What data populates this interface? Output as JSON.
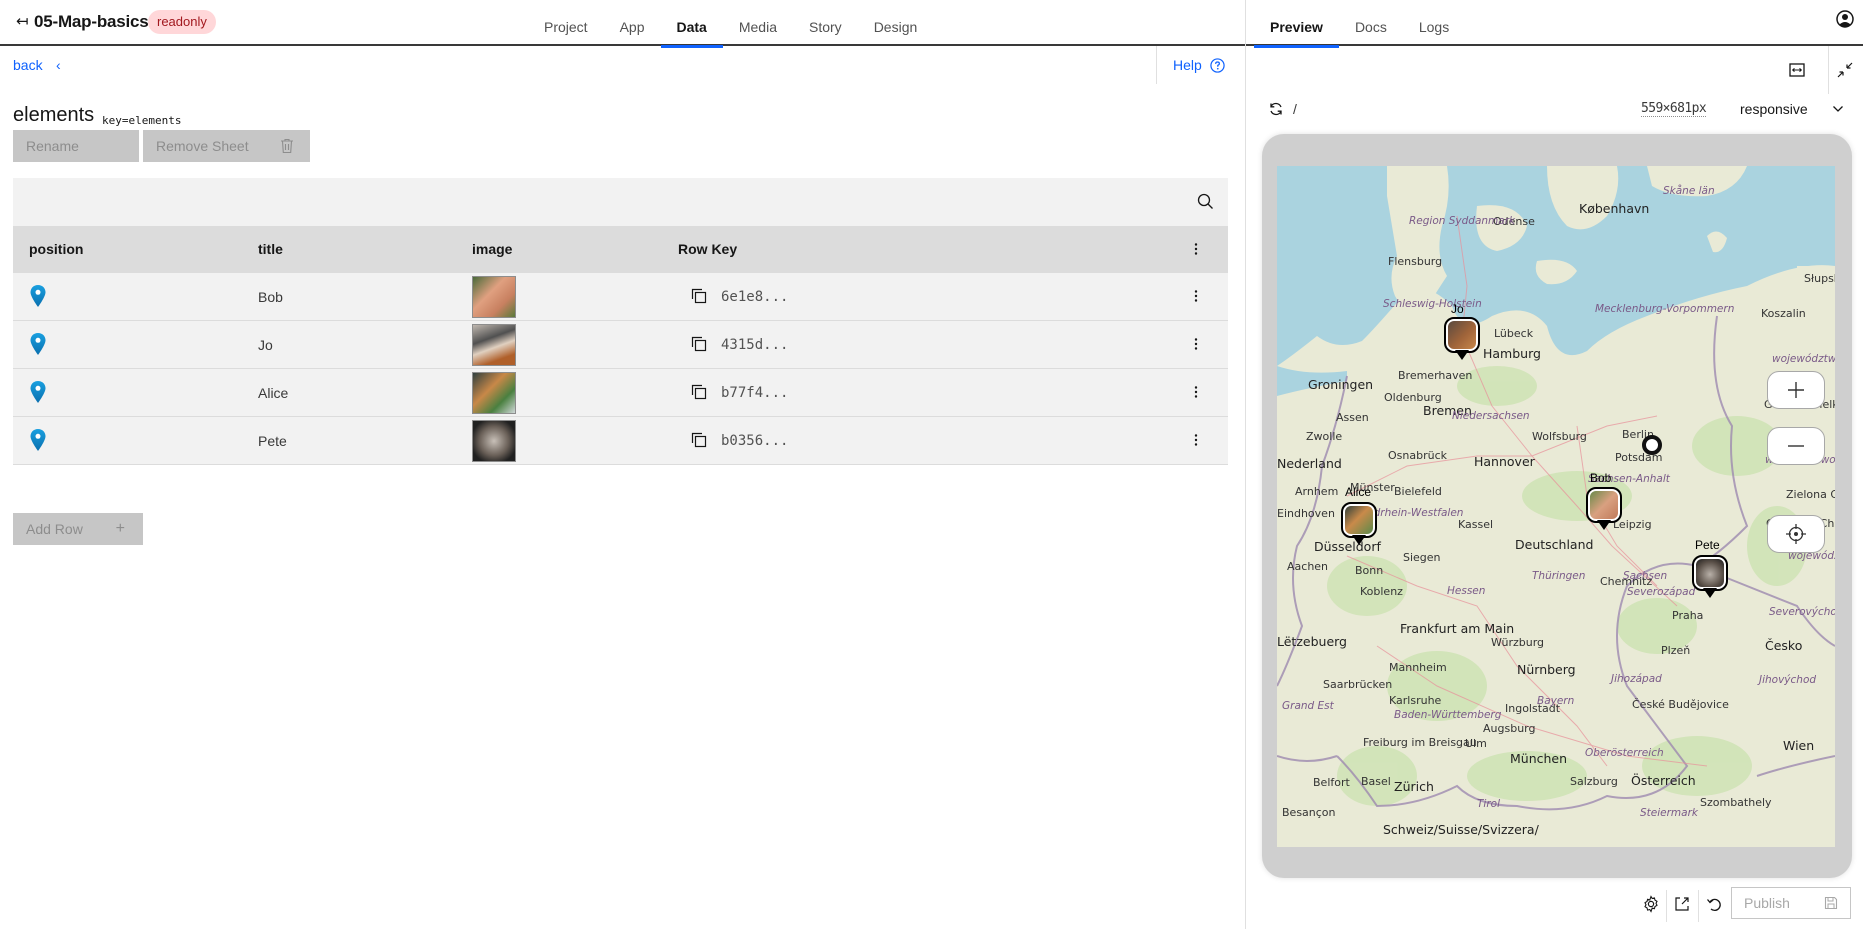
{
  "header": {
    "back_icon": "exit-arrow-icon",
    "app_title": "05-Map-basics",
    "badge": "readonly",
    "tabs": [
      {
        "label": "Project",
        "active": false
      },
      {
        "label": "App",
        "active": false
      },
      {
        "label": "Data",
        "active": true
      },
      {
        "label": "Media",
        "active": false
      },
      {
        "label": "Story",
        "active": false
      },
      {
        "label": "Design",
        "active": false
      }
    ],
    "accent_color": "#0f62fe"
  },
  "preview_panel": {
    "tabs": [
      {
        "label": "Preview",
        "active": true
      },
      {
        "label": "Docs",
        "active": false
      },
      {
        "label": "Logs",
        "active": false
      }
    ],
    "path": "/",
    "dimensions": "559×681px",
    "viewport_mode": "responsive"
  },
  "data_panel": {
    "back_label": "back",
    "help_label": "Help",
    "sheet_title": "elements",
    "sheet_key": "key=elements",
    "rename_label": "Rename",
    "remove_sheet_label": "Remove Sheet",
    "add_row_label": "Add Row",
    "table": {
      "columns": [
        "position",
        "title",
        "image",
        "Row Key"
      ],
      "rows": [
        {
          "title": "Bob",
          "row_key": "6e1e8...",
          "image": "orange tabby cat in grass"
        },
        {
          "title": "Jo",
          "row_key": "4315d...",
          "image": "two cats curled in bed"
        },
        {
          "title": "Alice",
          "row_key": "b77f4...",
          "image": "cat with plant"
        },
        {
          "title": "Pete",
          "row_key": "b0356...",
          "image": "scottish fold kitten"
        }
      ]
    }
  },
  "map": {
    "markers": [
      {
        "label": "Jo",
        "near": "Hamburg"
      },
      {
        "label": "Alice",
        "near": "Düsseldorf"
      },
      {
        "label": "Bob",
        "near": "Leipzig"
      },
      {
        "label": "Pete",
        "near": "Praha"
      }
    ],
    "places": [
      "København",
      "Odense",
      "Region Syddanmark",
      "Skåne län",
      "Flensburg",
      "Schleswig-Holstein",
      "Lübeck",
      "Hamburg",
      "Mecklenburg-Vorpommern",
      "Słupsk",
      "Koszalin",
      "województwo zachodniopomorskie",
      "Groningen",
      "Bremerhaven",
      "Oldenburg",
      "Bremen",
      "Assen",
      "Gorzów Wielkopolski",
      "Zwolle",
      "Niedersachsen",
      "Wolfsburg",
      "Berlin",
      "Potsdam",
      "Osnabrück",
      "Hannover",
      "Nederland",
      "Arnhem",
      "Münster",
      "Bielefeld",
      "Sachsen-Anhalt",
      "województwo lubuskie",
      "Zielona Góra",
      "Eindhoven",
      "Nordrhein-Westfalen",
      "Kassel",
      "Leipzig",
      "Cottbus - Chóśebuz",
      "Düsseldorf",
      "Deutschland",
      "Siegen",
      "Aachen",
      "Bonn",
      "Thüringen",
      "Sachsen",
      "Chemnitz",
      "województwo dolnośląskie",
      "Koblenz",
      "Hessen",
      "Severozápad",
      "Praha",
      "Severovýchod",
      "Frankfurt am Main",
      "Würzburg",
      "Lëtzebuerg",
      "Plzeň",
      "Česko",
      "Mannheim",
      "Nürnberg",
      "Saarbrücken",
      "Karlsruhe",
      "Jihozápad",
      "Jihovýchod",
      "Grand Est",
      "Baden-Württemberg",
      "Ingolstadt",
      "Bayern",
      "České Budějovice",
      "Augsburg",
      "Ulm",
      "Freiburg im Breisgau",
      "München",
      "Oberösterreich",
      "Wien",
      "Belfort",
      "Basel",
      "Zürich",
      "Salzburg",
      "Österreich",
      "Szombathely",
      "Besançon",
      "Tirol",
      "Steiermark",
      "Schweiz/Suisse/Svizzera/"
    ]
  },
  "footer": {
    "publish_label": "Publish"
  }
}
